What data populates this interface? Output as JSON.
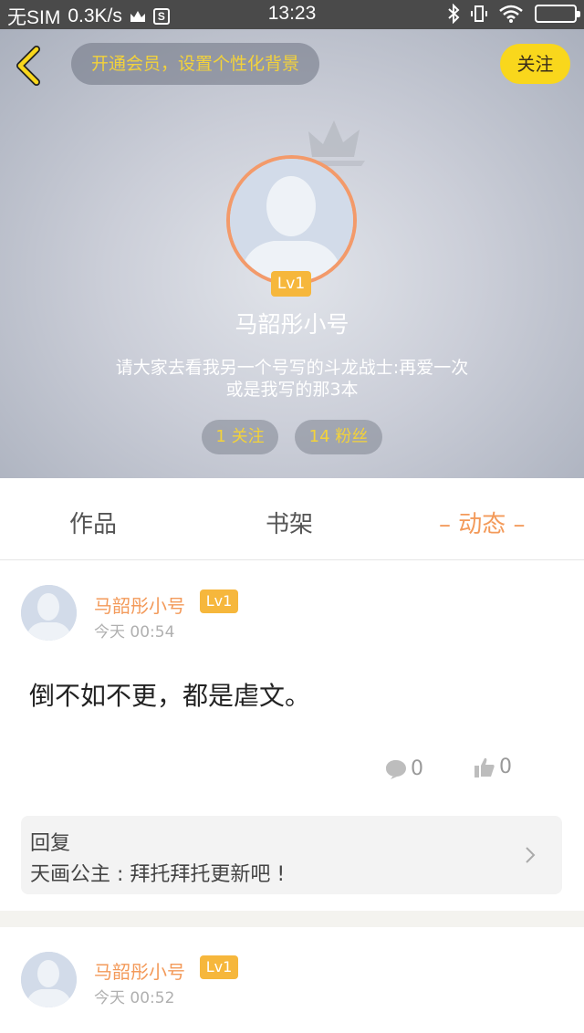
{
  "status_bar": {
    "carrier": "无SIM",
    "speed": "0.3K/s",
    "time": "13:23"
  },
  "header": {
    "vip_text": "开通会员，设置个性化背景",
    "follow_label": "关注",
    "profile_name": "马韶彤小号",
    "level": "Lv1",
    "bio_line1": "请大家去看我另一个号写的斗龙战士:再爱一次",
    "bio_line2": "或是我写的那3本",
    "following": "1 关注",
    "fans": "14 粉丝",
    "accent_color": "#f9d71c",
    "avatar_ring_color": "#f39a6a"
  },
  "tabs": [
    {
      "label": "作品",
      "active": false
    },
    {
      "label": "书架",
      "active": false
    },
    {
      "label": "– 动态 –",
      "active": true
    }
  ],
  "posts": [
    {
      "author": "马韶彤小号",
      "level": "Lv1",
      "time": "今天 00:54",
      "content": "倒不如不更，都是虐文。",
      "comments": "0",
      "likes": "0",
      "reply_title": "回复",
      "reply_text": "天画公主 : 拜托拜托更新吧 !"
    },
    {
      "author": "马韶彤小号",
      "level": "Lv1",
      "time": "今天 00:52"
    }
  ],
  "icons": [
    "back-icon",
    "crown-icon",
    "comment-icon",
    "thumbs-up-icon",
    "chevron-right-icon",
    "bluetooth-icon",
    "wifi-icon",
    "battery-icon"
  ]
}
